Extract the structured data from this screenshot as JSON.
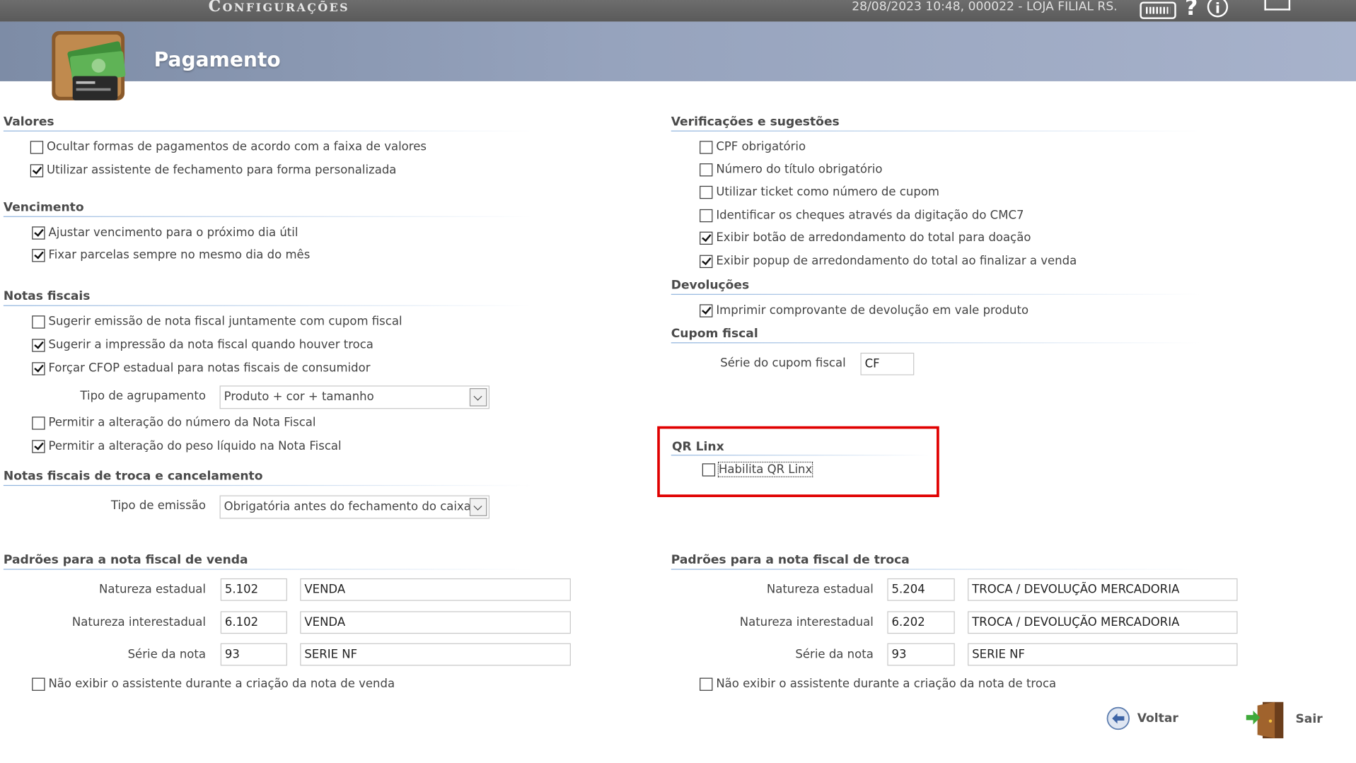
{
  "header": {
    "app_title": "Configurações",
    "session": "28/08/2023 10:48, 000022 - LOJA FILIAL RS.",
    "help_glyph": "?",
    "info_glyph": "i",
    "page_title": "Pagamento"
  },
  "left": {
    "valores": {
      "title": "Valores",
      "items": [
        {
          "label": "Ocultar formas de pagamentos de acordo com a faixa de valores",
          "checked": false
        },
        {
          "label": "Utilizar assistente de fechamento para forma personalizada",
          "checked": true
        }
      ]
    },
    "vencimento": {
      "title": "Vencimento",
      "items": [
        {
          "label": "Ajustar vencimento para o próximo dia útil",
          "checked": true
        },
        {
          "label": "Fixar parcelas sempre no mesmo dia do mês",
          "checked": true
        }
      ]
    },
    "notas": {
      "title": "Notas fiscais",
      "items": [
        {
          "label": "Sugerir emissão de nota fiscal juntamente com cupom fiscal",
          "checked": false
        },
        {
          "label": "Sugerir a impressão da nota fiscal quando houver troca",
          "checked": true
        },
        {
          "label": "Forçar CFOP estadual para notas fiscais de consumidor",
          "checked": true
        },
        {
          "label": "Permitir a alteração do número da Nota Fiscal",
          "checked": false
        },
        {
          "label": "Permitir a alteração do peso líquido na Nota Fiscal",
          "checked": true
        }
      ],
      "agrupamento_label": "Tipo de agrupamento",
      "agrupamento_value": "Produto + cor + tamanho"
    },
    "troca_cancel": {
      "title": "Notas fiscais de troca e cancelamento",
      "emissao_label": "Tipo de emissão",
      "emissao_value": "Obrigatória antes do fechamento do caixa"
    },
    "venda": {
      "title": "Padrões para a nota fiscal de venda",
      "rows": [
        {
          "label": "Natureza estadual",
          "code": "5.102",
          "desc": "VENDA"
        },
        {
          "label": "Natureza interestadual",
          "code": "6.102",
          "desc": "VENDA"
        },
        {
          "label": "Série da nota",
          "code": "93",
          "desc": "SERIE NF"
        }
      ],
      "no_wizard": {
        "label": "Não exibir o assistente durante a criação da nota de venda",
        "checked": false
      }
    }
  },
  "right": {
    "verificacoes": {
      "title": "Verificações e sugestões",
      "items": [
        {
          "label": "CPF obrigatório",
          "checked": false
        },
        {
          "label": "Número do título obrigatório",
          "checked": false
        },
        {
          "label": "Utilizar ticket como número de cupom",
          "checked": false
        },
        {
          "label": "Identificar os cheques através da digitação do CMC7",
          "checked": false
        },
        {
          "label": "Exibir botão de arredondamento do total para doação",
          "checked": true
        },
        {
          "label": "Exibir popup de arredondamento do total ao finalizar a venda",
          "checked": true
        }
      ]
    },
    "devolucoes": {
      "title": "Devoluções",
      "items": [
        {
          "label": "Imprimir comprovante de devolução em vale produto",
          "checked": true
        }
      ]
    },
    "cupom": {
      "title": "Cupom fiscal",
      "serie_label": "Série do cupom fiscal",
      "serie_value": "CF"
    },
    "qr": {
      "title": "QR Linx",
      "item": {
        "label": "Habilita QR Linx",
        "checked": false
      }
    },
    "troca": {
      "title": "Padrões para a nota fiscal de troca",
      "rows": [
        {
          "label": "Natureza estadual",
          "code": "5.204",
          "desc": "TROCA / DEVOLUÇÃO MERCADORIA"
        },
        {
          "label": "Natureza interestadual",
          "code": "6.202",
          "desc": "TROCA / DEVOLUÇÃO MERCADORIA"
        },
        {
          "label": "Série da nota",
          "code": "93",
          "desc": "SERIE NF"
        }
      ],
      "no_wizard": {
        "label": "Não exibir o assistente durante a criação da nota de troca",
        "checked": false
      }
    }
  },
  "footer": {
    "back_label": "Voltar",
    "exit_label": "Sair"
  },
  "colors": {
    "highlight": "#e00000",
    "banner": "#96a3bd",
    "titlebar": "#5f5f5f"
  },
  "icons": [
    "wallet-icon",
    "keyboard-icon",
    "help-icon",
    "info-icon",
    "minimize-icon",
    "back-arrow-icon",
    "exit-door-icon",
    "dropdown-arrow-icon"
  ]
}
